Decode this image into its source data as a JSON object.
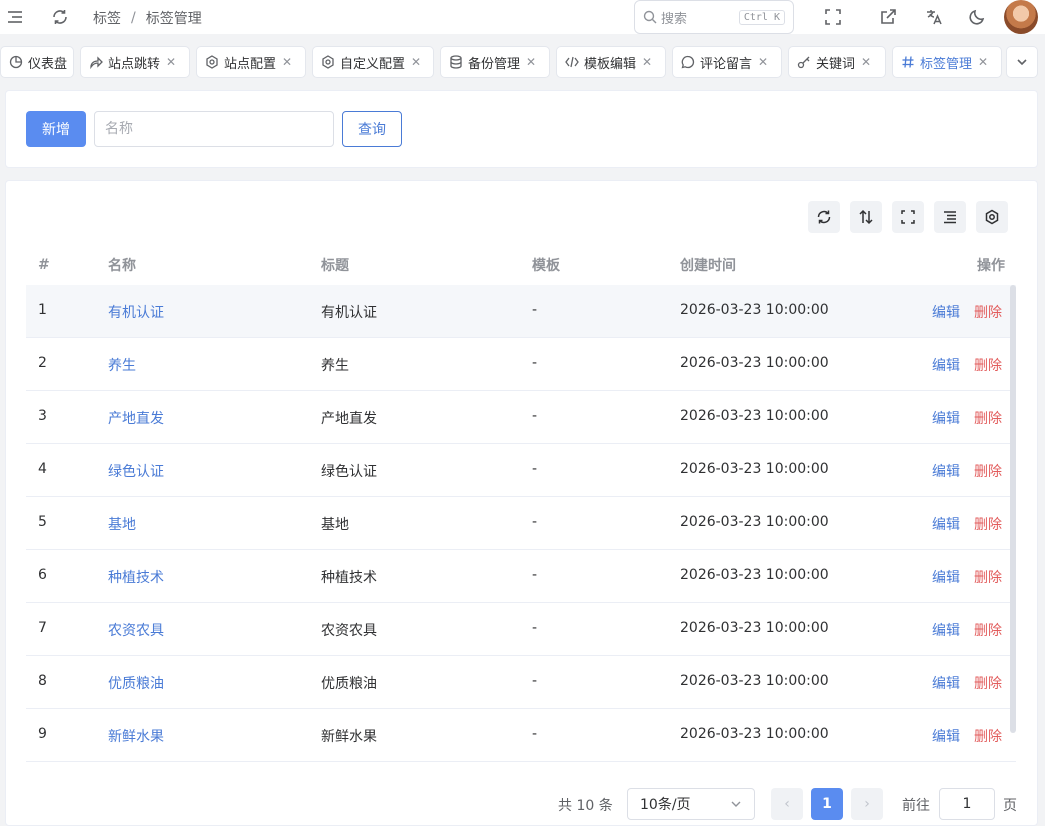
{
  "header": {
    "breadcrumb": [
      "标签",
      "标签管理"
    ],
    "breadcrumb_sep": "/",
    "search_placeholder": "搜索",
    "search_shortcut": "Ctrl K"
  },
  "tabs": [
    {
      "label": "仪表盘",
      "icon": "dashboard-icon",
      "closable": false
    },
    {
      "label": "站点跳转",
      "icon": "share-icon",
      "closable": true
    },
    {
      "label": "站点配置",
      "icon": "gear-icon",
      "closable": true
    },
    {
      "label": "自定义配置",
      "icon": "gear-icon",
      "closable": true
    },
    {
      "label": "备份管理",
      "icon": "database-icon",
      "closable": true
    },
    {
      "label": "模板编辑",
      "icon": "code-icon",
      "closable": true
    },
    {
      "label": "评论留言",
      "icon": "chat-icon",
      "closable": true
    },
    {
      "label": "关键词",
      "icon": "key-icon",
      "closable": true
    },
    {
      "label": "标签管理",
      "icon": "hash-icon",
      "closable": true,
      "active": true
    }
  ],
  "toolbar": {
    "add_label": "新增",
    "name_placeholder": "名称",
    "query_label": "查询"
  },
  "table": {
    "columns": [
      "#",
      "名称",
      "标题",
      "模板",
      "创建时间",
      "操作"
    ],
    "rows": [
      {
        "index": "1",
        "name": "有机认证",
        "title": "有机认证",
        "template": "-",
        "created": "2026-03-23 10:00:00"
      },
      {
        "index": "2",
        "name": "养生",
        "title": "养生",
        "template": "-",
        "created": "2026-03-23 10:00:00"
      },
      {
        "index": "3",
        "name": "产地直发",
        "title": "产地直发",
        "template": "-",
        "created": "2026-03-23 10:00:00"
      },
      {
        "index": "4",
        "name": "绿色认证",
        "title": "绿色认证",
        "template": "-",
        "created": "2026-03-23 10:00:00"
      },
      {
        "index": "5",
        "name": "基地",
        "title": "基地",
        "template": "-",
        "created": "2026-03-23 10:00:00"
      },
      {
        "index": "6",
        "name": "种植技术",
        "title": "种植技术",
        "template": "-",
        "created": "2026-03-23 10:00:00"
      },
      {
        "index": "7",
        "name": "农资农具",
        "title": "农资农具",
        "template": "-",
        "created": "2026-03-23 10:00:00"
      },
      {
        "index": "8",
        "name": "优质粮油",
        "title": "优质粮油",
        "template": "-",
        "created": "2026-03-23 10:00:00"
      },
      {
        "index": "9",
        "name": "新鲜水果",
        "title": "新鲜水果",
        "template": "-",
        "created": "2026-03-23 10:00:00"
      }
    ],
    "edit_label": "编辑",
    "delete_label": "删除"
  },
  "pagination": {
    "total_text": "共 10 条",
    "page_size": "10条/页",
    "current_page": "1",
    "goto_label": "前往",
    "goto_value": "1",
    "page_suffix": "页"
  },
  "colors": {
    "primary": "#5a8cf0",
    "link": "#4a7bd6",
    "danger": "#e25c5c"
  }
}
